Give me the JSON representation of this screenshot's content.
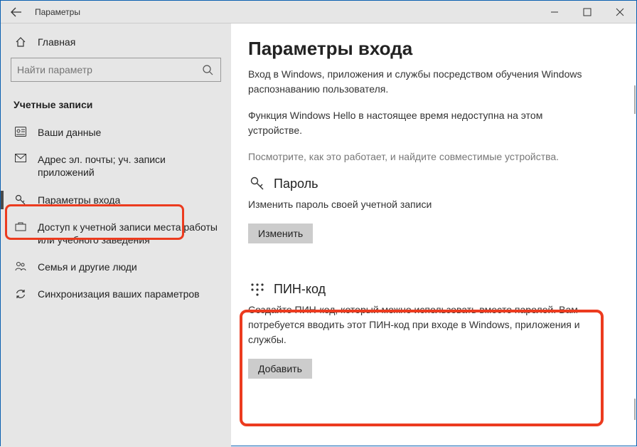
{
  "window": {
    "title": "Параметры"
  },
  "sidebar": {
    "home_label": "Главная",
    "search_placeholder": "Найти параметр",
    "section_title": "Учетные записи",
    "items": [
      {
        "label": "Ваши данные"
      },
      {
        "label": "Адрес эл. почты; уч. записи приложений"
      },
      {
        "label": "Параметры входа"
      },
      {
        "label": "Доступ к учетной записи места работы или учебного заведения"
      },
      {
        "label": "Семья и другие люди"
      },
      {
        "label": "Синхронизация ваших параметров"
      }
    ]
  },
  "main": {
    "title": "Параметры входа",
    "intro": "Вход в Windows, приложения и службы посредством обучения Windows распознаванию пользователя.",
    "hello_unavailable": "Функция Windows Hello в настоящее время недоступна на этом устройстве.",
    "hello_help": "Посмотрите, как это работает, и найдите совместимые устройства.",
    "password": {
      "heading": "Пароль",
      "desc": "Изменить пароль своей учетной записи",
      "button": "Изменить"
    },
    "pin": {
      "heading": "ПИН-код",
      "desc": "Создайте ПИН-код, который можно использовать вместо паролей. Вам потребуется вводить этот ПИН-код при входе в Windows, приложения и службы.",
      "button": "Добавить"
    }
  }
}
